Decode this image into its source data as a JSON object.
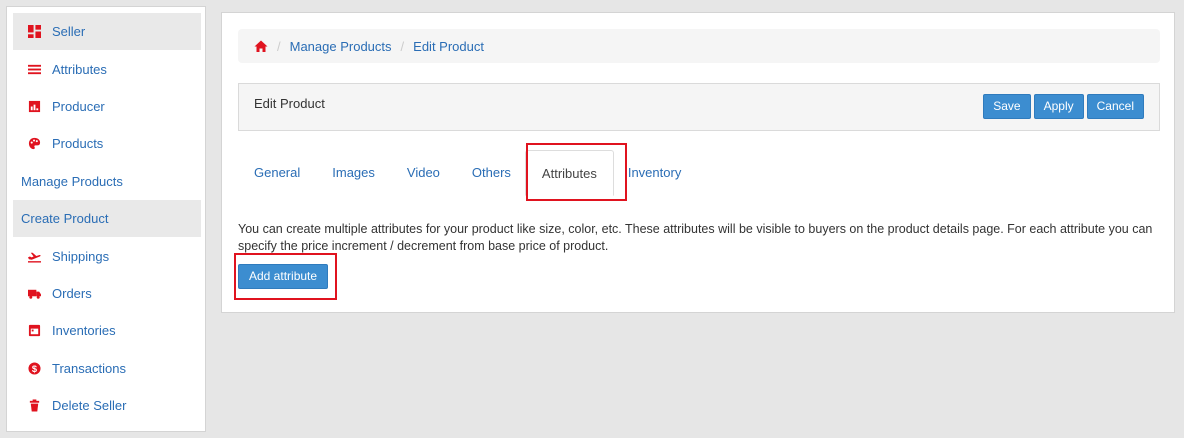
{
  "sidebar": {
    "items": [
      {
        "label": "Seller",
        "icon": "dashboard-icon"
      },
      {
        "label": "Attributes",
        "icon": "list-icon"
      },
      {
        "label": "Producer",
        "icon": "bar-chart-icon"
      },
      {
        "label": "Products",
        "icon": "palette-icon"
      },
      {
        "label": "Manage Products"
      },
      {
        "label": "Create Product"
      },
      {
        "label": "Shippings",
        "icon": "plane-icon"
      },
      {
        "label": "Orders",
        "icon": "truck-icon"
      },
      {
        "label": "Inventories",
        "icon": "calendar-icon"
      },
      {
        "label": "Transactions",
        "icon": "dollar-icon"
      },
      {
        "label": "Delete Seller",
        "icon": "trash-icon"
      }
    ]
  },
  "breadcrumb": {
    "items": [
      "Manage Products",
      "Edit Product"
    ]
  },
  "panel": {
    "title": "Edit Product",
    "save_label": "Save",
    "apply_label": "Apply",
    "cancel_label": "Cancel"
  },
  "tabs": [
    "General",
    "Images",
    "Video",
    "Others",
    "Attributes",
    "Inventory"
  ],
  "attributes_tab": {
    "description": "You can create multiple attributes for your product like size, color, etc. These attributes will be visible to buyers on the product details page. For each attribute you can specify the price increment / decrement from base price of product.",
    "add_button_label": "Add attribute"
  },
  "colors": {
    "accent": "#3c8dd0",
    "link": "#2a6db5",
    "icon_red": "#e0131f",
    "highlight_box": "#e0131f"
  }
}
